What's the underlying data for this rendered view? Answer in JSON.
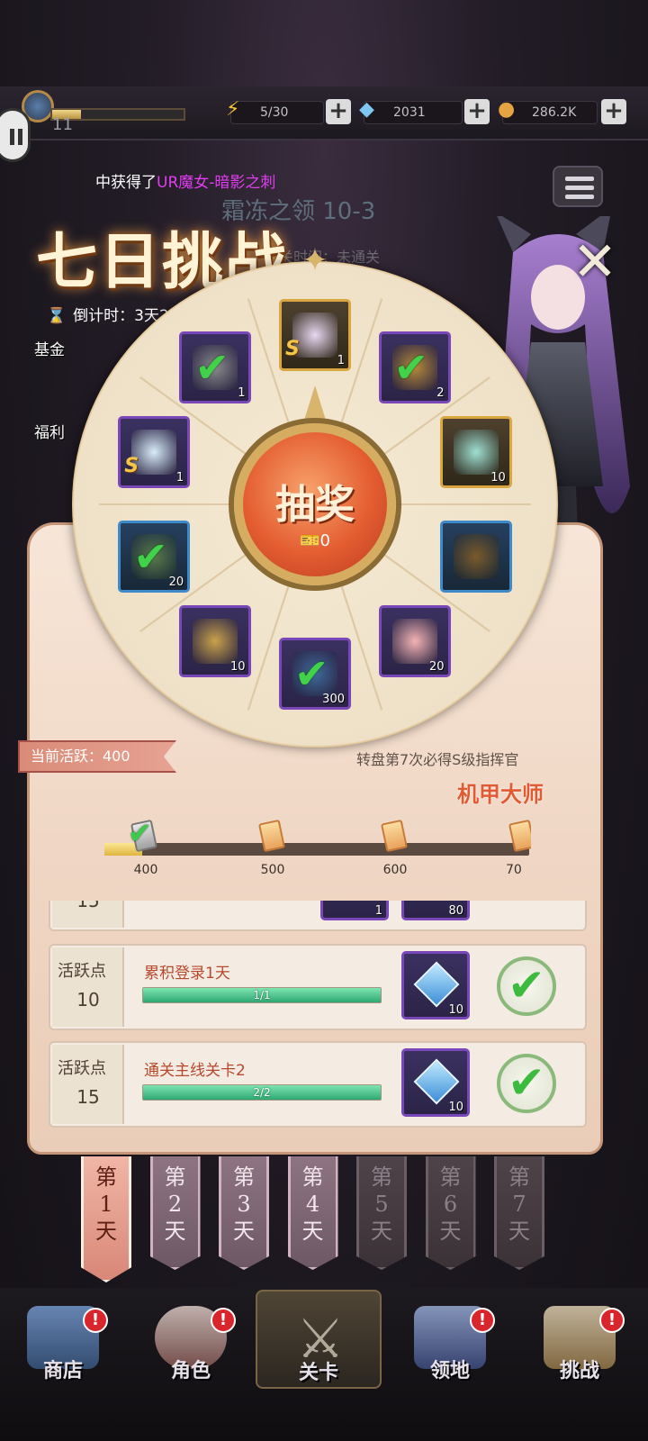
{
  "topbar": {
    "level": "11",
    "level_progress": 0.22,
    "energy": "5/30",
    "gems": "2031",
    "gold": "286.2K"
  },
  "background": {
    "stage_title": "霜冻之领 10-3",
    "stage_sub": "通关时间：未通关",
    "side_labels": [
      "基金",
      "福利"
    ]
  },
  "notice": {
    "prefix": "中获得了",
    "highlight": "UR魔女-暗影之刺"
  },
  "event": {
    "title": "七日挑战",
    "countdown": "倒计时：3天23时4分"
  },
  "wheel": {
    "spin_label": "抽奖",
    "ticket_count": "0",
    "slots": [
      {
        "name": "slot-top-character",
        "qty": "1",
        "type": "gold",
        "claimed": false,
        "s_rank": true
      },
      {
        "name": "slot-top-right-coin",
        "qty": "2",
        "type": "purple",
        "claimed": true,
        "s_rank": false
      },
      {
        "name": "slot-right-shield",
        "qty": "10",
        "type": "gold",
        "claimed": false,
        "s_rank": false
      },
      {
        "name": "slot-right-book",
        "qty": "",
        "type": "blue",
        "claimed": false,
        "s_rank": false
      },
      {
        "name": "slot-bottom-right-cake",
        "qty": "20",
        "type": "purple",
        "claimed": false,
        "s_rank": false
      },
      {
        "name": "slot-bottom-crystal",
        "qty": "300",
        "type": "purple",
        "claimed": true,
        "s_rank": false
      },
      {
        "name": "slot-bottom-left-key",
        "qty": "10",
        "type": "purple",
        "claimed": false,
        "s_rank": false
      },
      {
        "name": "slot-left-item",
        "qty": "20",
        "type": "blue",
        "claimed": true,
        "s_rank": false
      },
      {
        "name": "slot-left-character",
        "qty": "1",
        "type": "purple",
        "claimed": false,
        "s_rank": true
      },
      {
        "name": "slot-top-left-ticket",
        "qty": "1",
        "type": "purple",
        "claimed": true,
        "s_rank": false
      }
    ]
  },
  "activity": {
    "current": "当前活跃：400",
    "guarantee": "转盘第7次必得S级指挥官",
    "commander": "机甲大师",
    "progress": 0.09,
    "milestones": [
      "400",
      "500",
      "600",
      "70"
    ]
  },
  "tasks": {
    "partial_row": {
      "pts": "15",
      "qty1": "1",
      "qty2": "80"
    },
    "rows": [
      {
        "pts_label": "活跃点",
        "pts": "10",
        "name": "累积登录1天",
        "progress": "1/1",
        "reward_qty": "10"
      },
      {
        "pts_label": "活跃点",
        "pts": "15",
        "name": "通关主线关卡2",
        "progress": "2/2",
        "reward_qty": "10"
      }
    ]
  },
  "days": [
    {
      "label": "第1天",
      "l1": "第",
      "l2": "1",
      "l3": "天",
      "state": "active"
    },
    {
      "label": "第2天",
      "l1": "第",
      "l2": "2",
      "l3": "天",
      "state": "normal"
    },
    {
      "label": "第3天",
      "l1": "第",
      "l2": "3",
      "l3": "天",
      "state": "normal"
    },
    {
      "label": "第4天",
      "l1": "第",
      "l2": "4",
      "l3": "天",
      "state": "normal"
    },
    {
      "label": "第5天",
      "l1": "第",
      "l2": "5",
      "l3": "天",
      "state": "locked"
    },
    {
      "label": "第6天",
      "l1": "第",
      "l2": "6",
      "l3": "天",
      "state": "locked"
    },
    {
      "label": "第7天",
      "l1": "第",
      "l2": "7",
      "l3": "天",
      "state": "locked"
    }
  ],
  "nav": {
    "shop": "商店",
    "character": "角色",
    "stage": "关卡",
    "territory": "领地",
    "challenge": "挑战",
    "badge": "!"
  }
}
